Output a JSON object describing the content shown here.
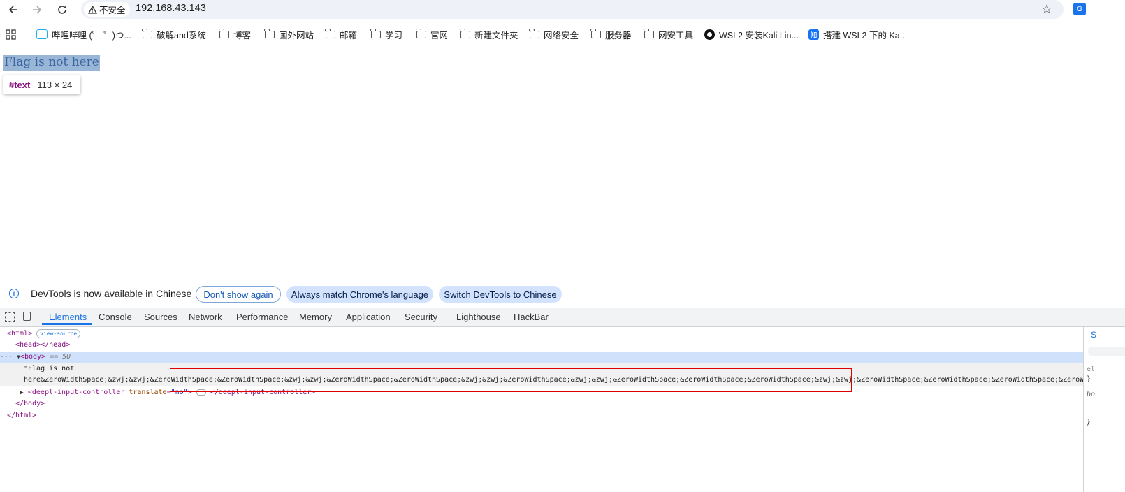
{
  "browser": {
    "secure_label": "不安全",
    "url": "192.168.43.143",
    "profile_badge": "G"
  },
  "bookmarks": [
    {
      "label": "哔哩哔哩 (゜-゜)つ...",
      "icon": "bilibili-icon"
    },
    {
      "label": "破解and系统",
      "icon": "folder-icon"
    },
    {
      "label": "博客",
      "icon": "folder-icon"
    },
    {
      "label": "国外网站",
      "icon": "folder-icon"
    },
    {
      "label": "邮箱",
      "icon": "folder-icon"
    },
    {
      "label": "学习",
      "icon": "folder-icon"
    },
    {
      "label": "官网",
      "icon": "folder-icon"
    },
    {
      "label": "新建文件夹",
      "icon": "folder-icon"
    },
    {
      "label": "网络安全",
      "icon": "folder-icon"
    },
    {
      "label": "服务器",
      "icon": "folder-icon"
    },
    {
      "label": "网安工具",
      "icon": "folder-icon"
    },
    {
      "label": "WSL2 安装Kali Lin...",
      "icon": "github-icon"
    },
    {
      "label": "搭建 WSL2 下的 Ka...",
      "icon": "zhihu-icon"
    }
  ],
  "page": {
    "text": "Flag is not here",
    "tooltip_tag": "#text",
    "tooltip_dims": "113 × 24"
  },
  "devtools": {
    "info_message": "DevTools is now available in Chinese",
    "btn_dont_show": "Don't show again",
    "btn_always_match": "Always match Chrome's language",
    "btn_switch": "Switch DevTools to Chinese",
    "tabs": [
      "Elements",
      "Console",
      "Sources",
      "Network",
      "Performance",
      "Memory",
      "Application",
      "Security",
      "Lighthouse",
      "HackBar"
    ],
    "dom": {
      "html_open": "<html>",
      "view_source": "view-source",
      "head": "<head></head>",
      "body_open": "<body>",
      "body_ref": "== $0",
      "text_line1": "\"Flag is not",
      "text_line2": "here&ZeroWidthSpace;&zwj;&zwj;&ZeroWidthSpace;&ZeroWidthSpace;&zwj;&zwj;&ZeroWidthSpace;&ZeroWidthSpace;&zwj;&zwj;&ZeroWidthSpace;&zwj;&zwj;&ZeroWidthSpace;&ZeroWidthSpace;&ZeroWidthSpace;&zwj;&zwj;&ZeroWidthSpace;&ZeroWidthSpace;&ZeroWidthSpace;&ZeroWidthSpace;&ZeroWidthSpace;&ZeroWidthSpace;&ZeroWidthSpace;",
      "deepl_tag": "deepl-input-controller",
      "deepl_attr": "translate",
      "deepl_val": "\"no\"",
      "body_close": "</body>",
      "html_close": "</html>"
    },
    "side_tab": "S"
  }
}
